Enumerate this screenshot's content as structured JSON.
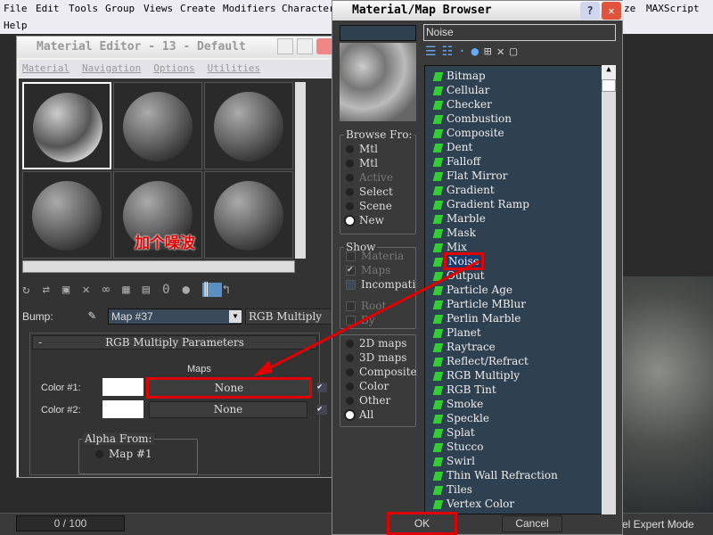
{
  "menubar": {
    "items": [
      "File",
      "Edit",
      "Tools",
      "Group",
      "Views",
      "Create",
      "Modifiers",
      "Character",
      "ze",
      "MAXScript",
      "Help"
    ]
  },
  "material_editor": {
    "title": "Material Editor - 13 - Default",
    "menu": [
      "Material",
      "Navigation",
      "Options",
      "Utilities"
    ],
    "bump_label": "Bump:",
    "map_name": "Map #37",
    "map_type": "RGB Multiply",
    "rollout_title": "RGB Multiply Parameters",
    "rollout_toggle": "-",
    "maps_label": "Maps",
    "color1_label": "Color #1:",
    "color2_label": "Color #2:",
    "color1_map": "None",
    "color2_map": "None",
    "alpha_from": "Alpha From:",
    "alpha_option": "Map #1"
  },
  "annotation": {
    "text": "加个噪波",
    "color": "#e00000"
  },
  "browser": {
    "title": "Material/Map Browser",
    "search_value": "Noise",
    "browse_from": {
      "label": "Browse Fro:",
      "options": [
        "Mtl",
        "Mtl",
        "Active",
        "Select",
        "Scene",
        "New"
      ],
      "selected": "New"
    },
    "show": {
      "label": "Show",
      "options": [
        "Materia",
        "Maps",
        "Incompati"
      ],
      "extra": [
        "Root",
        "By"
      ]
    },
    "filter": {
      "options": [
        "2D maps",
        "3D maps",
        "Composite",
        "Color",
        "Other",
        "All"
      ],
      "selected": "All"
    },
    "items": [
      "Bitmap",
      "Cellular",
      "Checker",
      "Combustion",
      "Composite",
      "Dent",
      "Falloff",
      "Flat Mirror",
      "Gradient",
      "Gradient Ramp",
      "Marble",
      "Mask",
      "Mix",
      "Noise",
      "Output",
      "Particle Age",
      "Particle MBlur",
      "Perlin Marble",
      "Planet",
      "Raytrace",
      "Reflect/Refract",
      "RGB Multiply",
      "RGB Tint",
      "Smoke",
      "Speckle",
      "Splat",
      "Stucco",
      "Swirl",
      "Thin Wall Refraction",
      "Tiles",
      "Vertex Color"
    ],
    "selected_item": "Noise",
    "ok": "OK",
    "cancel": "Cancel"
  },
  "status": {
    "frame": "0 / 100",
    "mode": "cel Expert Mode"
  }
}
